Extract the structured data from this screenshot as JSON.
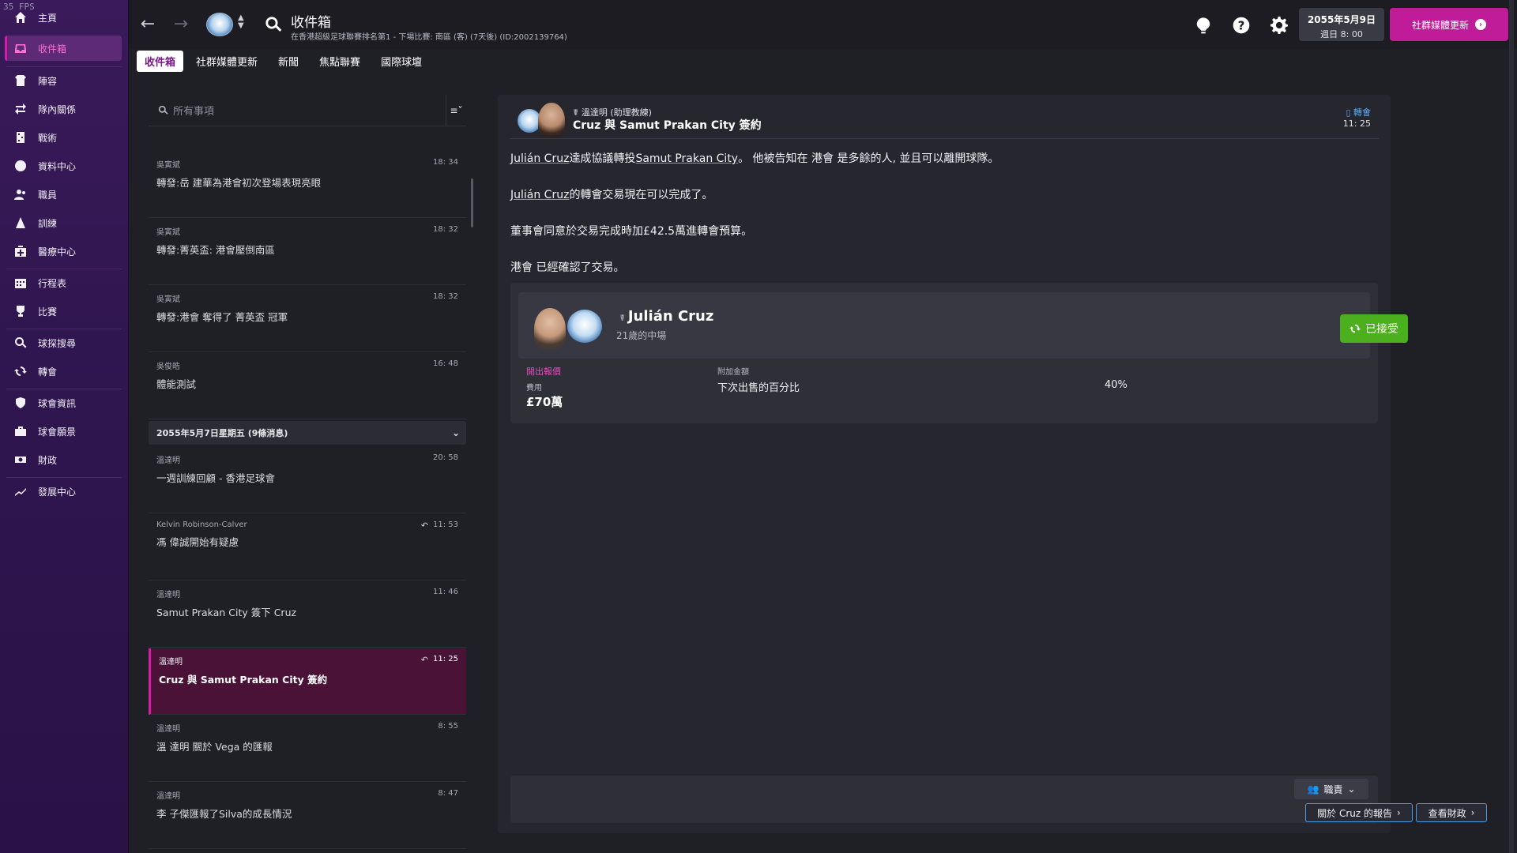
{
  "fps": "35 FPS",
  "sidebar": {
    "items": [
      {
        "label": "主頁",
        "icon": "home-icon"
      },
      {
        "label": "收件箱",
        "icon": "inbox-icon"
      },
      {
        "label": "陣容",
        "icon": "squad-icon"
      },
      {
        "label": "隊內關係",
        "icon": "dynamics-icon"
      },
      {
        "label": "戰術",
        "icon": "tactics-icon"
      },
      {
        "label": "資料中心",
        "icon": "data-hub-icon"
      },
      {
        "label": "職員",
        "icon": "staff-icon"
      },
      {
        "label": "訓練",
        "icon": "training-icon"
      },
      {
        "label": "醫療中心",
        "icon": "medical-icon"
      },
      {
        "label": "行程表",
        "icon": "schedule-icon"
      },
      {
        "label": "比賽",
        "icon": "trophy-icon"
      },
      {
        "label": "球探搜尋",
        "icon": "scouting-icon"
      },
      {
        "label": "轉會",
        "icon": "transfers-icon"
      },
      {
        "label": "球會資訊",
        "icon": "club-info-icon"
      },
      {
        "label": "球會願景",
        "icon": "club-vision-icon"
      },
      {
        "label": "財政",
        "icon": "finances-icon"
      },
      {
        "label": "發展中心",
        "icon": "development-icon"
      }
    ]
  },
  "header": {
    "title": "收件箱",
    "subtitle": "在香港超級足球聯賽排名第1 - 下場比賽: 南區 (客) (7天後) (ID:2002139764)",
    "date_line1": "2055年5月9日",
    "date_line2": "週日 8: 00",
    "social_button": "社群媒體更新"
  },
  "tabs": [
    "收件箱",
    "社群媒體更新",
    "新聞",
    "焦點聯賽",
    "國際球壇"
  ],
  "inbox": {
    "search_placeholder": "所有事項",
    "group_header": "2055年5月7日星期五 (9條消息)",
    "messages_before": [
      {
        "from": "吳寅斌",
        "time": "18: 34",
        "subject": "轉發:岳 建華為港會初次登場表現亮眼"
      },
      {
        "from": "吳寅斌",
        "time": "18: 32",
        "subject": "轉發:菁英盃: 港會壓倒南區"
      },
      {
        "from": "吳寅斌",
        "time": "18: 32",
        "subject": "轉發:港會 奪得了 菁英盃 冠軍"
      },
      {
        "from": "吳俊皓",
        "time": "16: 48",
        "subject": "體能測試"
      }
    ],
    "messages_after": [
      {
        "from": "溫達明",
        "time": "20: 58",
        "subject": "一週訓練回顧 - 香港足球會"
      },
      {
        "from": "Kelvin Robinson-Calver",
        "time": "11: 53",
        "subject": "馮 偉誠開始有疑慮"
      },
      {
        "from": "溫達明",
        "time": "11: 46",
        "subject": "Samut Prakan City 簽下 Cruz"
      },
      {
        "from": "溫達明",
        "time": "11: 25",
        "subject": "Cruz 與 Samut Prakan City 簽約"
      },
      {
        "from": "溫達明",
        "time": "8: 55",
        "subject": "溫 達明 關於 Vega 的匯報"
      },
      {
        "from": "溫達明",
        "time": "8: 47",
        "subject": "李 子傑匯報了Silva的成長情況"
      }
    ]
  },
  "detail": {
    "sender": "溫達明 (助理教練)",
    "title": "Cruz 與 Samut Prakan City 簽約",
    "tag": "轉會",
    "time": "11: 25",
    "p1_player": "Julián Cruz",
    "p1_a": "達成協議轉投",
    "p1_club": "Samut Prakan City",
    "p1_b": "。 他被告知在 港會 是多餘的人, 並且可以離開球隊。",
    "p2_player": "Julián Cruz",
    "p2_b": "的轉會交易現在可以完成了。",
    "p3": "董事會同意於交易完成時加£42.5萬進轉會預算。",
    "p4": "港會 已經確認了交易。",
    "card": {
      "player_name": "Julián Cruz",
      "player_sub": "21歲的中場",
      "status": "已接受",
      "offer_label": "開出報價",
      "fee_label": "費用",
      "fee_value": "£70萬",
      "extra_label": "附加金額",
      "extra_item": "下次出售的百分比",
      "extra_value": "40%"
    },
    "staff_button": "職責",
    "report_button": "關於 Cruz 的報告",
    "finance_button": "查看財政"
  }
}
